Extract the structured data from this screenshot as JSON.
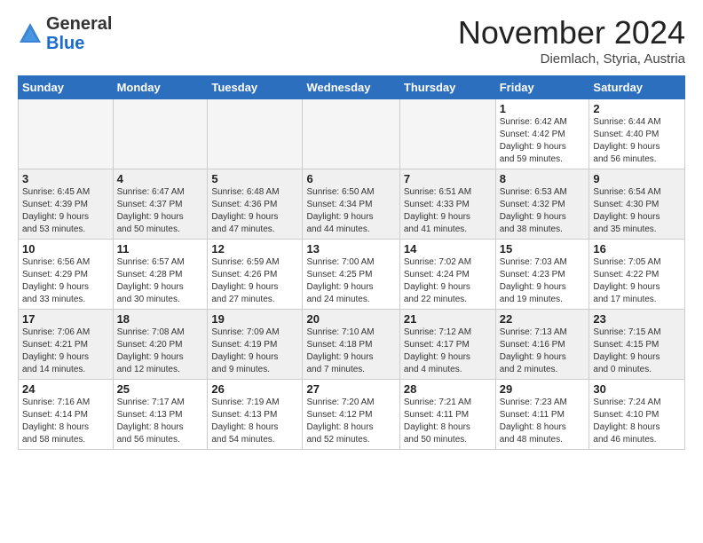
{
  "logo": {
    "general": "General",
    "blue": "Blue"
  },
  "header": {
    "month": "November 2024",
    "location": "Diemlach, Styria, Austria"
  },
  "weekdays": [
    "Sunday",
    "Monday",
    "Tuesday",
    "Wednesday",
    "Thursday",
    "Friday",
    "Saturday"
  ],
  "weeks": [
    [
      {
        "day": "",
        "info": ""
      },
      {
        "day": "",
        "info": ""
      },
      {
        "day": "",
        "info": ""
      },
      {
        "day": "",
        "info": ""
      },
      {
        "day": "",
        "info": ""
      },
      {
        "day": "1",
        "info": "Sunrise: 6:42 AM\nSunset: 4:42 PM\nDaylight: 9 hours\nand 59 minutes."
      },
      {
        "day": "2",
        "info": "Sunrise: 6:44 AM\nSunset: 4:40 PM\nDaylight: 9 hours\nand 56 minutes."
      }
    ],
    [
      {
        "day": "3",
        "info": "Sunrise: 6:45 AM\nSunset: 4:39 PM\nDaylight: 9 hours\nand 53 minutes."
      },
      {
        "day": "4",
        "info": "Sunrise: 6:47 AM\nSunset: 4:37 PM\nDaylight: 9 hours\nand 50 minutes."
      },
      {
        "day": "5",
        "info": "Sunrise: 6:48 AM\nSunset: 4:36 PM\nDaylight: 9 hours\nand 47 minutes."
      },
      {
        "day": "6",
        "info": "Sunrise: 6:50 AM\nSunset: 4:34 PM\nDaylight: 9 hours\nand 44 minutes."
      },
      {
        "day": "7",
        "info": "Sunrise: 6:51 AM\nSunset: 4:33 PM\nDaylight: 9 hours\nand 41 minutes."
      },
      {
        "day": "8",
        "info": "Sunrise: 6:53 AM\nSunset: 4:32 PM\nDaylight: 9 hours\nand 38 minutes."
      },
      {
        "day": "9",
        "info": "Sunrise: 6:54 AM\nSunset: 4:30 PM\nDaylight: 9 hours\nand 35 minutes."
      }
    ],
    [
      {
        "day": "10",
        "info": "Sunrise: 6:56 AM\nSunset: 4:29 PM\nDaylight: 9 hours\nand 33 minutes."
      },
      {
        "day": "11",
        "info": "Sunrise: 6:57 AM\nSunset: 4:28 PM\nDaylight: 9 hours\nand 30 minutes."
      },
      {
        "day": "12",
        "info": "Sunrise: 6:59 AM\nSunset: 4:26 PM\nDaylight: 9 hours\nand 27 minutes."
      },
      {
        "day": "13",
        "info": "Sunrise: 7:00 AM\nSunset: 4:25 PM\nDaylight: 9 hours\nand 24 minutes."
      },
      {
        "day": "14",
        "info": "Sunrise: 7:02 AM\nSunset: 4:24 PM\nDaylight: 9 hours\nand 22 minutes."
      },
      {
        "day": "15",
        "info": "Sunrise: 7:03 AM\nSunset: 4:23 PM\nDaylight: 9 hours\nand 19 minutes."
      },
      {
        "day": "16",
        "info": "Sunrise: 7:05 AM\nSunset: 4:22 PM\nDaylight: 9 hours\nand 17 minutes."
      }
    ],
    [
      {
        "day": "17",
        "info": "Sunrise: 7:06 AM\nSunset: 4:21 PM\nDaylight: 9 hours\nand 14 minutes."
      },
      {
        "day": "18",
        "info": "Sunrise: 7:08 AM\nSunset: 4:20 PM\nDaylight: 9 hours\nand 12 minutes."
      },
      {
        "day": "19",
        "info": "Sunrise: 7:09 AM\nSunset: 4:19 PM\nDaylight: 9 hours\nand 9 minutes."
      },
      {
        "day": "20",
        "info": "Sunrise: 7:10 AM\nSunset: 4:18 PM\nDaylight: 9 hours\nand 7 minutes."
      },
      {
        "day": "21",
        "info": "Sunrise: 7:12 AM\nSunset: 4:17 PM\nDaylight: 9 hours\nand 4 minutes."
      },
      {
        "day": "22",
        "info": "Sunrise: 7:13 AM\nSunset: 4:16 PM\nDaylight: 9 hours\nand 2 minutes."
      },
      {
        "day": "23",
        "info": "Sunrise: 7:15 AM\nSunset: 4:15 PM\nDaylight: 9 hours\nand 0 minutes."
      }
    ],
    [
      {
        "day": "24",
        "info": "Sunrise: 7:16 AM\nSunset: 4:14 PM\nDaylight: 8 hours\nand 58 minutes."
      },
      {
        "day": "25",
        "info": "Sunrise: 7:17 AM\nSunset: 4:13 PM\nDaylight: 8 hours\nand 56 minutes."
      },
      {
        "day": "26",
        "info": "Sunrise: 7:19 AM\nSunset: 4:13 PM\nDaylight: 8 hours\nand 54 minutes."
      },
      {
        "day": "27",
        "info": "Sunrise: 7:20 AM\nSunset: 4:12 PM\nDaylight: 8 hours\nand 52 minutes."
      },
      {
        "day": "28",
        "info": "Sunrise: 7:21 AM\nSunset: 4:11 PM\nDaylight: 8 hours\nand 50 minutes."
      },
      {
        "day": "29",
        "info": "Sunrise: 7:23 AM\nSunset: 4:11 PM\nDaylight: 8 hours\nand 48 minutes."
      },
      {
        "day": "30",
        "info": "Sunrise: 7:24 AM\nSunset: 4:10 PM\nDaylight: 8 hours\nand 46 minutes."
      }
    ]
  ]
}
